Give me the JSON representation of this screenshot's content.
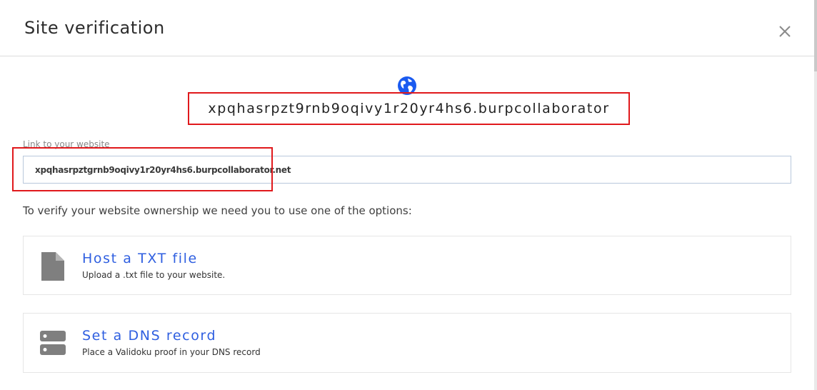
{
  "dialog": {
    "title": "Site verification",
    "close_icon": "close-icon"
  },
  "site": {
    "icon": "globe-icon",
    "domain": "xpqhasrpzt9rnb9oqivy1r20yr4hs6.burpcollaborator"
  },
  "website_link": {
    "label": "Link to your website",
    "value": "xpqhasrpztgrnb9oqivy1r20yr4hs6.burpcollaborator.net"
  },
  "instructions": "To verify your website ownership we need you to use one of the options:",
  "options": [
    {
      "icon": "file-icon",
      "title": "Host a TXT file",
      "description": "Upload a .txt file to your website."
    },
    {
      "icon": "server-icon",
      "title": "Set a DNS record",
      "description": "Place a Validoku proof in your DNS record"
    }
  ],
  "colors": {
    "accent": "#2f5fe0",
    "highlight": "#e0191c",
    "icon_gray": "#7f7f7f"
  }
}
